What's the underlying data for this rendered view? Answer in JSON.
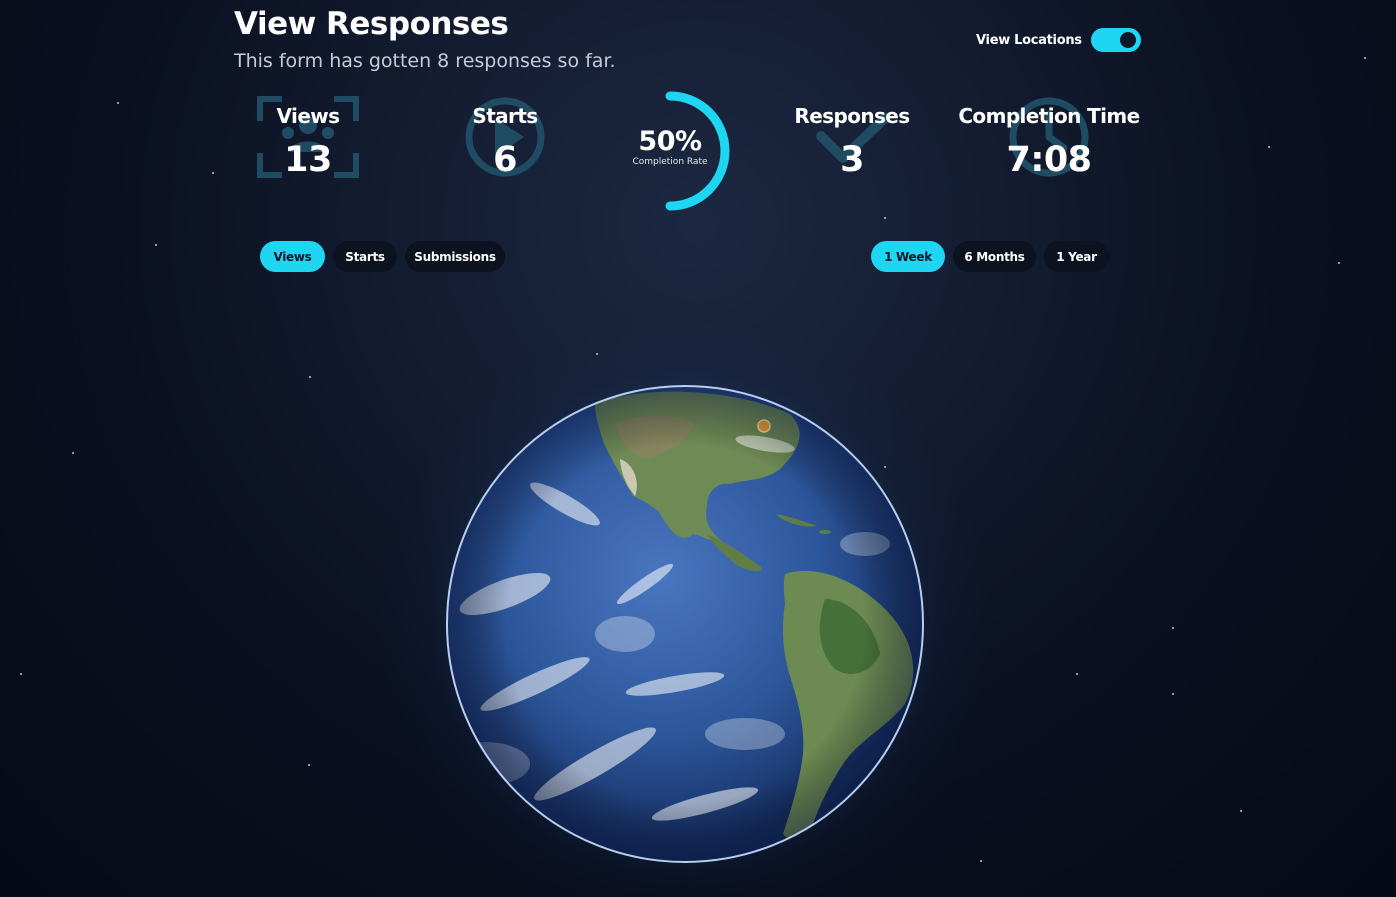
{
  "header": {
    "title": "View Responses",
    "subtitle": "This form has gotten 8 responses so far."
  },
  "toggle": {
    "label": "View Locations",
    "on": true
  },
  "stats": {
    "views": {
      "label": "Views",
      "value": "13",
      "icon": "views-scan-icon"
    },
    "starts": {
      "label": "Starts",
      "value": "6",
      "icon": "play-icon"
    },
    "completion_rate": {
      "value": "50%",
      "caption": "Completion Rate",
      "fraction": 0.5
    },
    "responses": {
      "label": "Responses",
      "value": "3",
      "icon": "checkmark-icon"
    },
    "completion_time": {
      "label": "Completion Time",
      "value": "7:08",
      "icon": "clock-icon"
    }
  },
  "metric_tabs": [
    {
      "label": "Views",
      "active": true
    },
    {
      "label": "Starts",
      "active": false
    },
    {
      "label": "Submissions",
      "active": false
    }
  ],
  "range_tabs": [
    {
      "label": "1 Week",
      "active": true
    },
    {
      "label": "6 Months",
      "active": false
    },
    {
      "label": "1 Year",
      "active": false
    }
  ],
  "globe": {
    "icon": "globe-earth-icon"
  },
  "colors": {
    "accent": "#1ed6f2",
    "icon_dim": "#1f4c62",
    "marker": "#f0a030"
  }
}
